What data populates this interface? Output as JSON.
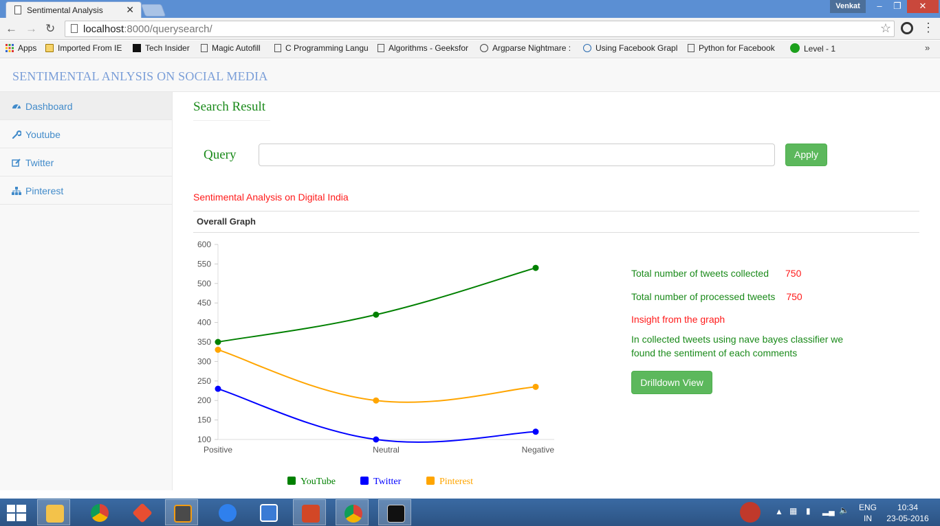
{
  "browser": {
    "tab_title": "Sentimental Analysis",
    "user_name": "Venkat",
    "url_host": "localhost",
    "url_path": ":8000/querysearch/",
    "bookmarks": [
      {
        "label": "Apps",
        "icon": "apps-grid-icon"
      },
      {
        "label": "Imported From IE",
        "icon": "folder-icon"
      },
      {
        "label": "Tech Insider",
        "icon": "ti-logo-icon"
      },
      {
        "label": "Magic Autofill",
        "icon": "page-icon"
      },
      {
        "label": "C Programming Langu",
        "icon": "page-icon"
      },
      {
        "label": "Algorithms - Geeksfor",
        "icon": "page-icon"
      },
      {
        "label": "Argparse Nightmare :",
        "icon": "reddit-icon"
      },
      {
        "label": "Using Facebook Grapl",
        "icon": "cloud-icon"
      },
      {
        "label": "Python for Facebook",
        "icon": "page-icon"
      },
      {
        "label": "Level - 1",
        "icon": "green-circle-icon"
      }
    ],
    "more_bookmarks": "»"
  },
  "header": {
    "brand": "SENTIMENTAL ANLYSIS ON SOCIAL MEDIA"
  },
  "sidebar": {
    "items": [
      {
        "label": "Dashboard",
        "icon": "dashboard-icon"
      },
      {
        "label": "Youtube",
        "icon": "wrench-icon"
      },
      {
        "label": "Twitter",
        "icon": "edit-icon"
      },
      {
        "label": "Pinterest",
        "icon": "sitemap-icon"
      }
    ]
  },
  "main": {
    "page_title": "Search Result",
    "query_label": "Query",
    "query_value": "",
    "apply_label": "Apply",
    "analysis_title": "Sentimental Analysis on Digital India",
    "graph_title": "Overall Graph",
    "stats": [
      {
        "label": "Total number of tweets collected",
        "value": "750"
      },
      {
        "label": "Total number of processed tweets",
        "value": "750"
      }
    ],
    "insight_title": "Insight from the graph",
    "insight_text": "In collected tweets using nave bayes classifier we found the sentiment of each comments",
    "drilldown_label": "Drilldown View"
  },
  "chart_data": {
    "type": "line",
    "categories": [
      "Positive",
      "Neutral",
      "Negative"
    ],
    "ylim": [
      100,
      600
    ],
    "yticks": [
      100,
      150,
      200,
      250,
      300,
      350,
      400,
      450,
      500,
      550,
      600
    ],
    "series": [
      {
        "name": "YouTube",
        "values": [
          350,
          420,
          540
        ],
        "color": "#008000"
      },
      {
        "name": "Twitter",
        "values": [
          230,
          100,
          120
        ],
        "color": "#0000ff"
      },
      {
        "name": "Pinterest",
        "values": [
          330,
          200,
          235
        ],
        "color": "#ffa500"
      }
    ],
    "legend_position": "bottom"
  },
  "taskbar": {
    "apps": [
      "file-explorer",
      "chrome",
      "git",
      "sublime-text",
      "app-launcher",
      "infinity-app",
      "powerpoint",
      "chrome-active",
      "command-prompt"
    ],
    "lang_top": "ENG",
    "lang_bottom": "IN",
    "time": "10:34",
    "date": "23-05-2016"
  }
}
